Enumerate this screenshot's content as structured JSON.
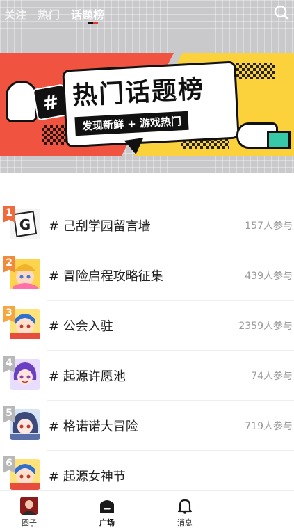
{
  "header": {
    "tabs": [
      {
        "label": "关注",
        "active": false
      },
      {
        "label": "热门",
        "active": false
      },
      {
        "label": "话题榜",
        "active": true
      }
    ],
    "search_icon": "search-icon",
    "indicator_colors": [
      "#111111",
      "#e53935"
    ]
  },
  "banner": {
    "title": "热门话题榜",
    "subtitle": "发现新鲜 + 游戏热门",
    "hash_symbol": "#",
    "colors": {
      "red": "#f0533f",
      "yellow": "#fbd13c",
      "ink": "#111111"
    }
  },
  "topics": [
    {
      "rank": "1",
      "name": "# 己刮学园留言墙",
      "count": "157人参与",
      "rank_color": "#f06a3c"
    },
    {
      "rank": "2",
      "name": "# 冒险启程攻略征集",
      "count": "439人参与",
      "rank_color": "#f08a3c"
    },
    {
      "rank": "3",
      "name": "# 公会入驻",
      "count": "2359人参与",
      "rank_color": "#f4a640"
    },
    {
      "rank": "4",
      "name": "# 起源许愿池",
      "count": "74人参与",
      "rank_color": "#b8b8b8"
    },
    {
      "rank": "5",
      "name": "# 格诺诺大冒险",
      "count": "719人参与",
      "rank_color": "#b8b8b8"
    },
    {
      "rank": "6",
      "name": "# 起源女神节",
      "count": "",
      "rank_color": "#b8b8b8"
    }
  ],
  "bottom_nav": [
    {
      "label": "圈子",
      "icon": "circle-avatar-icon",
      "active": false
    },
    {
      "label": "广场",
      "icon": "plaza-icon",
      "active": true
    },
    {
      "label": "消息",
      "icon": "bell-icon",
      "active": false
    }
  ]
}
